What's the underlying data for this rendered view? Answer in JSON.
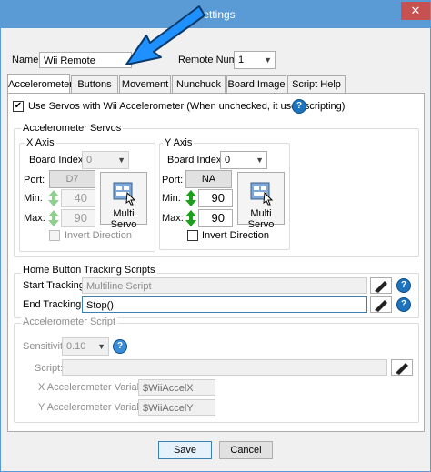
{
  "window": {
    "title": "Settings",
    "close_glyph": "✕"
  },
  "name": {
    "label": "Name",
    "value": "Wii Remote"
  },
  "remote": {
    "label": "Remote Num:",
    "value": "1"
  },
  "tabs": [
    {
      "label": "Accelerometer"
    },
    {
      "label": "Buttons"
    },
    {
      "label": "Movement"
    },
    {
      "label": "Nunchuck"
    },
    {
      "label": "Board Image"
    },
    {
      "label": "Script Help"
    }
  ],
  "use_servos": {
    "label": "Use Servos with Wii Accelerometer (When unchecked, it uses scripting)",
    "checked": true
  },
  "servos_group": {
    "title": "Accelerometer Servos"
  },
  "x_axis": {
    "title": "X Axis",
    "board_index_label": "Board Index:",
    "board_index": "0",
    "port_label": "Port:",
    "port": "D7",
    "min_label": "Min:",
    "min": "40",
    "max_label": "Max:",
    "max": "90",
    "multi_servo": "Multi Servo",
    "invert_label": "Invert Direction"
  },
  "y_axis": {
    "title": "Y Axis",
    "board_index_label": "Board Index:",
    "board_index": "0",
    "port_label": "Port:",
    "port": "NA",
    "min_label": "Min:",
    "min": "90",
    "max_label": "Max:",
    "max": "90",
    "multi_servo": "Multi Servo",
    "invert_label": "Invert Direction"
  },
  "home_group": {
    "title": "Home Button Tracking Scripts",
    "start_label": "Start Tracking:",
    "start_placeholder": "Multiline Script",
    "end_label": "End Tracking:",
    "end_value": "Stop()"
  },
  "accel_script": {
    "title": "Accelerometer Script",
    "sensitivity_label": "Sensitivity:",
    "sensitivity": "0.10",
    "script_label": "Script:",
    "x_var_label": "X Accelerometer Variable:",
    "x_var": "$WiiAccelX",
    "y_var_label": "Y Accelerometer Variable:",
    "y_var": "$WiiAccelY"
  },
  "buttons": {
    "save": "Save",
    "cancel": "Cancel"
  },
  "help_glyph": "?",
  "colors": {
    "titlebar": "#5b9bd5",
    "close": "#c75050",
    "annotation_arrow": "#1e90ff",
    "help": "#1e73be"
  }
}
